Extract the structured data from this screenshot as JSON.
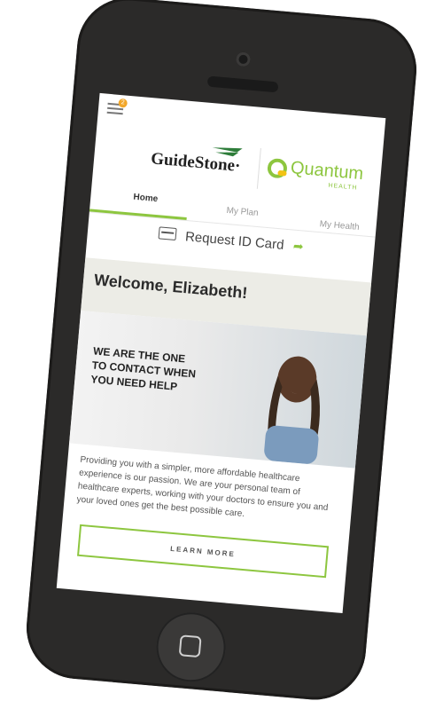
{
  "header": {
    "notification_count": "2"
  },
  "brand": {
    "guidestone": "GuideStone",
    "guidestone_mark": "·",
    "quantum": "Quantum",
    "quantum_sub": "HEALTH"
  },
  "tabs": [
    {
      "label": "Home",
      "active": true
    },
    {
      "label": "My Plan",
      "active": false
    },
    {
      "label": "My Health",
      "active": false
    }
  ],
  "request_card": {
    "label": "Request ID Card"
  },
  "welcome": {
    "text": "Welcome, Elizabeth!"
  },
  "hero": {
    "line1": "WE ARE THE ONE",
    "line2": "TO CONTACT WHEN",
    "line3": "YOU NEED HELP"
  },
  "description": "Providing you with a simpler, more affordable healthcare experience is our passion. We are your personal team of healthcare experts, working with your doctors to ensure you and your loved ones get the best possible care.",
  "cta": {
    "label": "LEARN MORE"
  },
  "colors": {
    "accent": "#8dc63f",
    "phone": "#2b2a29",
    "badge": "#f2a72a"
  }
}
